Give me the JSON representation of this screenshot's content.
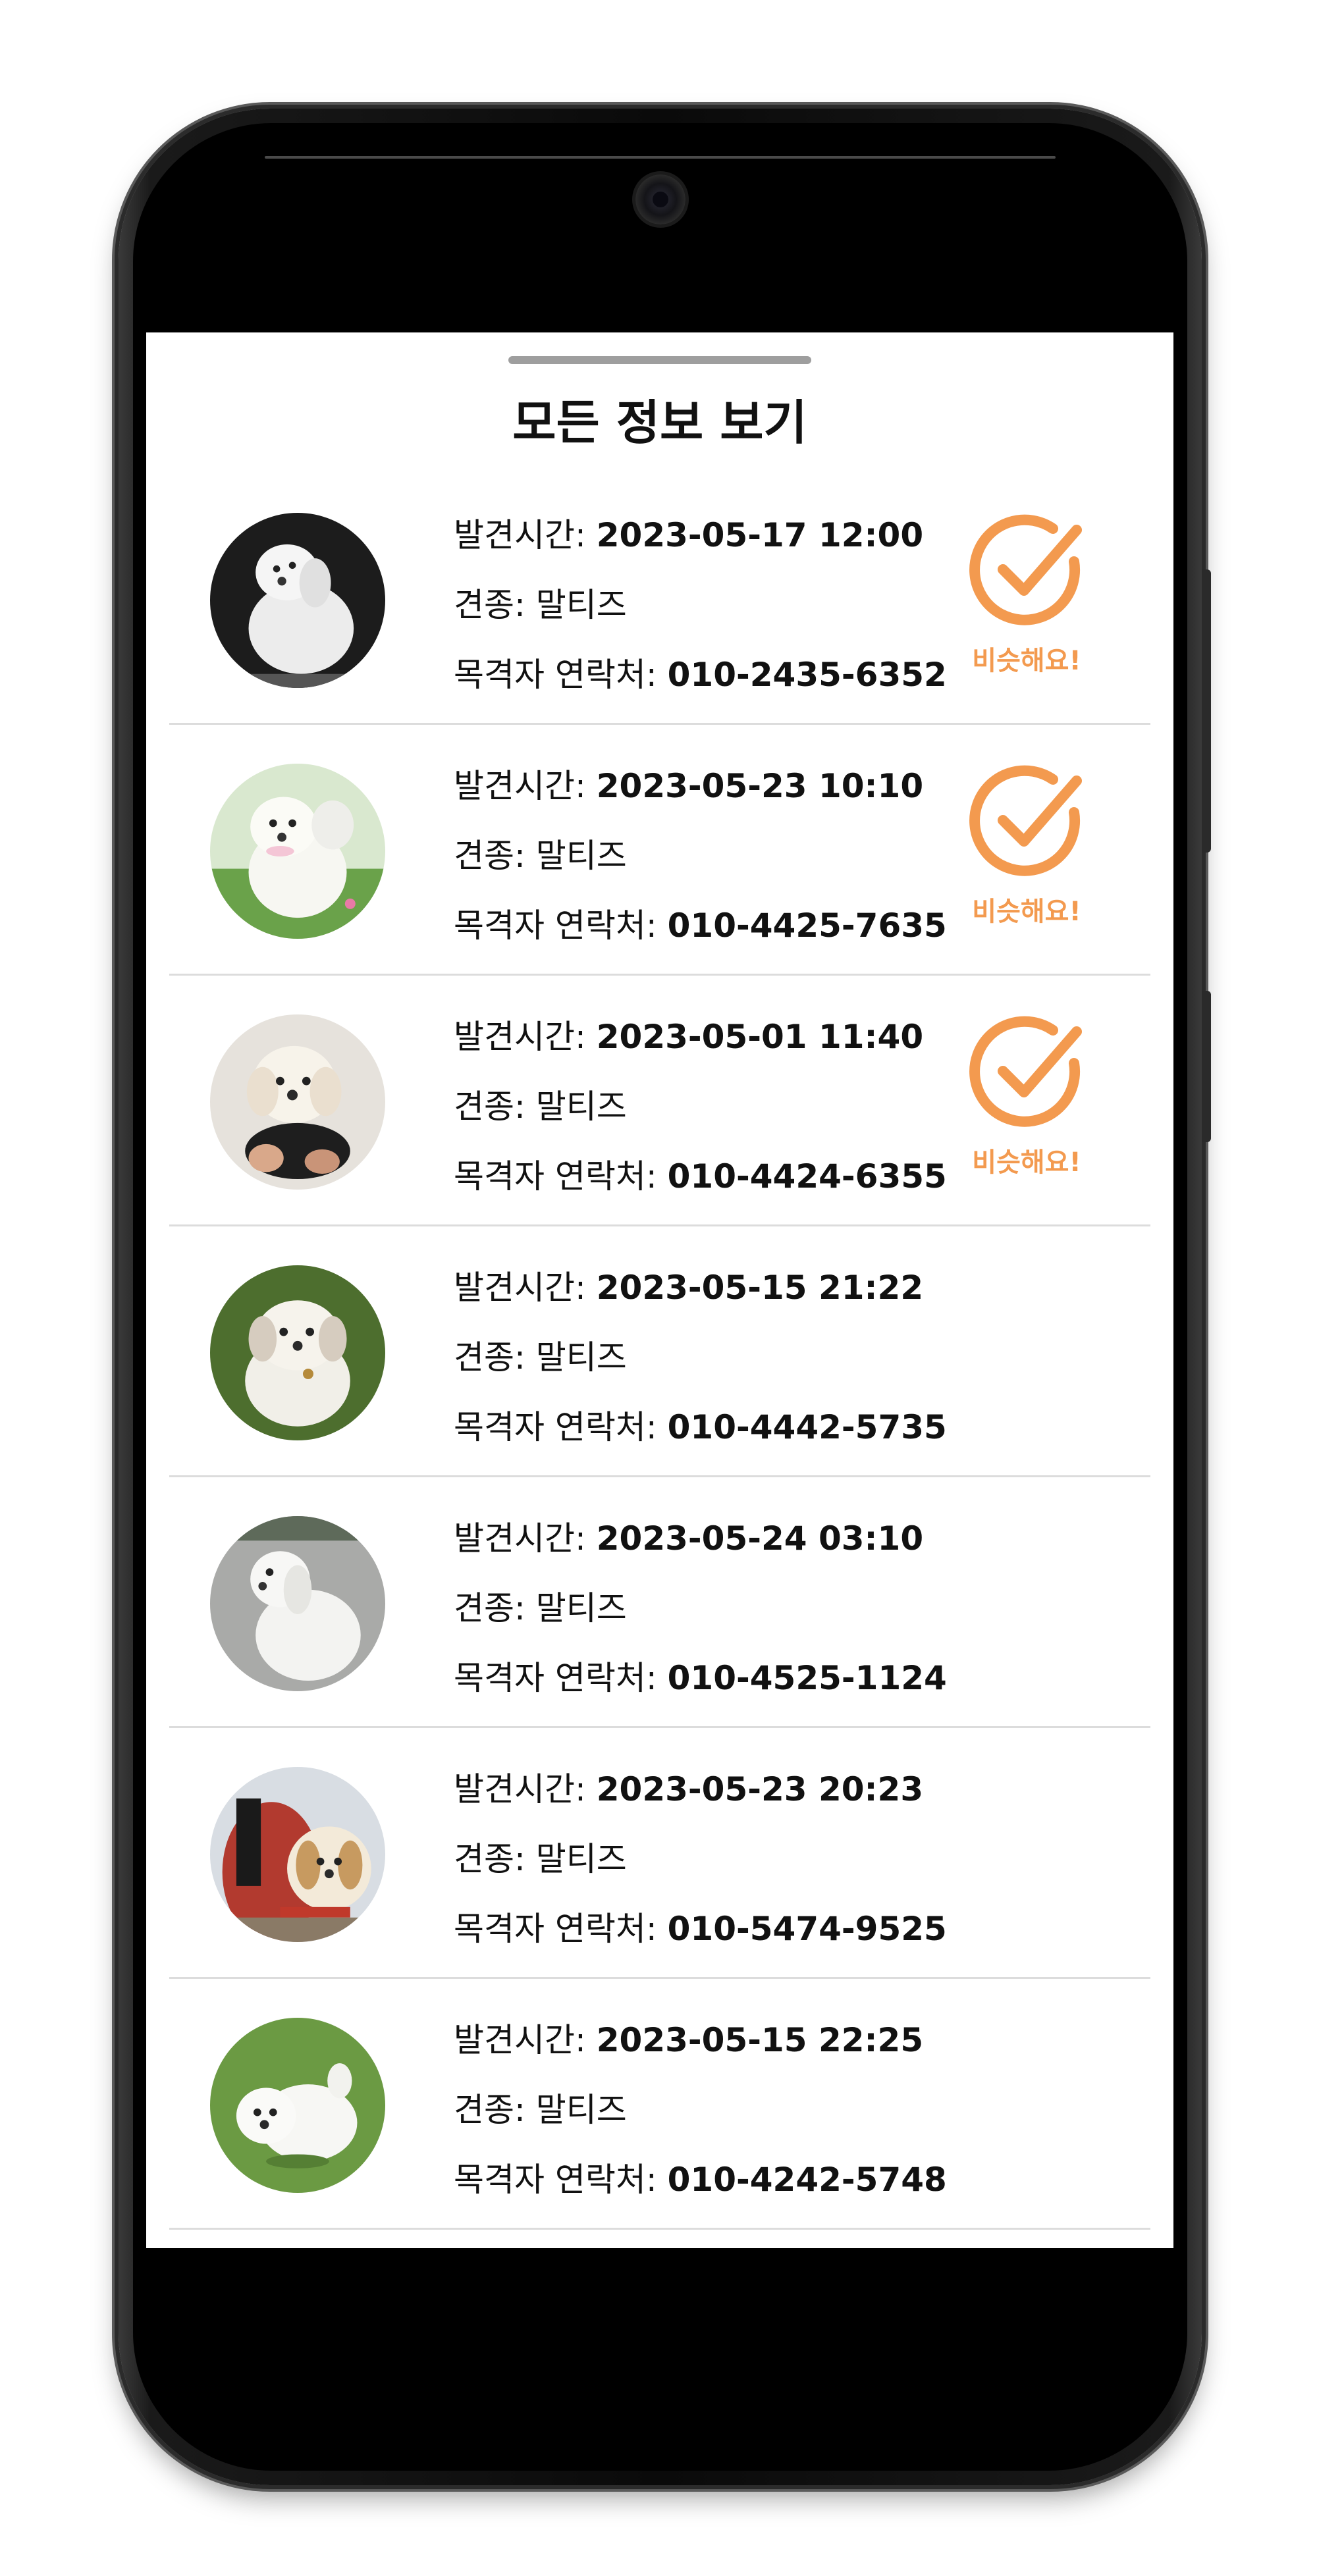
{
  "sheet": {
    "title": "모든 정보 보기"
  },
  "colors": {
    "accent": "#F39A4F",
    "divider": "#DCDCDC",
    "handle": "#9E9E9E"
  },
  "labels": {
    "time": "발견시간: ",
    "breed": "견종: ",
    "contact": "목격자 연락처: ",
    "similar": "비슷해요!"
  },
  "items": [
    {
      "time": "2023-05-17 12:00",
      "breed": "말티즈",
      "contact": "010-2435-6352",
      "similar": true,
      "photo": "dog-photo-dark-bg"
    },
    {
      "time": "2023-05-23 10:10",
      "breed": "말티즈",
      "contact": "010-4425-7635",
      "similar": true,
      "photo": "dog-photo-grass"
    },
    {
      "time": "2023-05-01 11:40",
      "breed": "말티즈",
      "contact": "010-4424-6355",
      "similar": true,
      "photo": "dog-photo-held"
    },
    {
      "time": "2023-05-15 21:22",
      "breed": "말티즈",
      "contact": "010-4442-5735",
      "similar": false,
      "photo": "dog-photo-grass-2"
    },
    {
      "time": "2023-05-24 03:10",
      "breed": "말티즈",
      "contact": "010-4525-1124",
      "similar": false,
      "photo": "dog-photo-pavement"
    },
    {
      "time": "2023-05-23 20:23",
      "breed": "말티즈",
      "contact": "010-5474-9525",
      "similar": false,
      "photo": "dog-photo-red-coat"
    },
    {
      "time": "2023-05-15 22:25",
      "breed": "말티즈",
      "contact": "010-4242-5748",
      "similar": false,
      "photo": "dog-photo-lawn"
    }
  ]
}
